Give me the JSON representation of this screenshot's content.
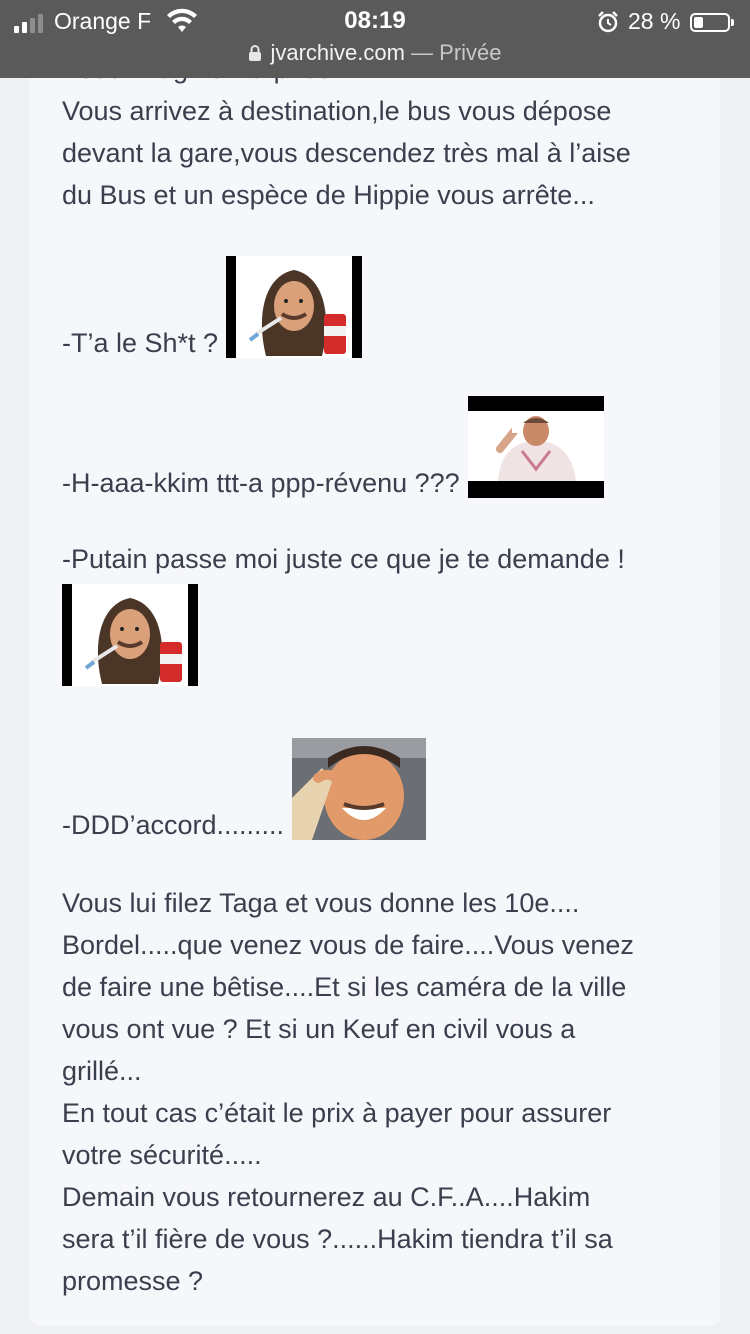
{
  "status_bar": {
    "carrier": "Orange F",
    "time": "08:19",
    "battery_percent": "28 %",
    "battery_level": 0.28
  },
  "url_bar": {
    "domain": "jvarchive.com",
    "separator": " — ",
    "mode": "Privée"
  },
  "post": {
    "cut_line": "Vous imaginez la prison.....",
    "para1": [
      "Vous arrivez à destination,le bus vous dépose",
      "devant la gare,vous descendez très mal à l’aise",
      "du Bus et un espèce de Hippie vous arrête..."
    ],
    "line_shit": "-T’a le Sh*t ?",
    "line_hakim": "-H-aaa-kkim ttt-a ppp-révenu ???",
    "line_putain": "-Putain passe moi juste ce que je te demande !",
    "line_daccord": "-DDD’accord.........",
    "para2": [
      "Vous lui filez Taga et vous donne les 10e....",
      "Bordel.....que venez vous de faire....Vous venez",
      "de faire une bêtise....Et si les caméra de la ville",
      "vous ont vue ? Et si un Keuf en civil vous a",
      "grillé...",
      "En tout cas c’était le prix à payer pour assurer",
      "votre sécurité.....",
      "Demain vous retournerez au C.F..A....Hakim",
      "sera t’il fière de vous ?......Hakim tiendra t’il sa",
      "promesse ?"
    ]
  },
  "stickers": {
    "hippie": "hippie-smoking-sticker",
    "crying": "crying-man-sticker",
    "laughing": "laughing-man-sticker"
  }
}
